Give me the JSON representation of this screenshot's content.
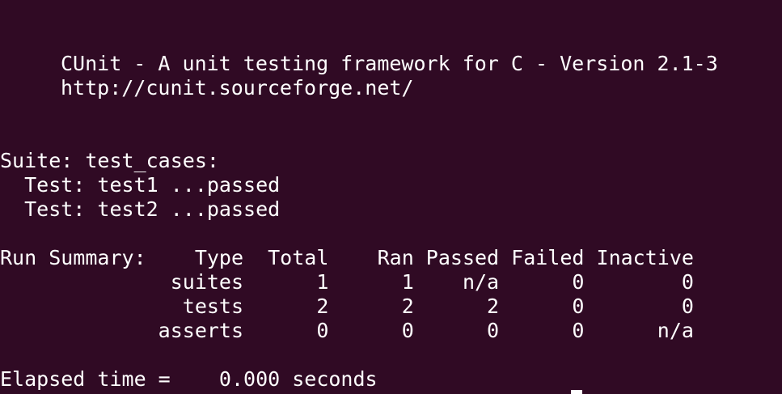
{
  "terminal": {
    "banner": {
      "title": "CUnit - A unit testing framework for C - Version 2.1-3",
      "url": "http://cunit.sourceforge.net/"
    },
    "suite_line": "Suite: test_cases:",
    "tests": [
      "  Test: test1 ...passed",
      "  Test: test2 ...passed"
    ],
    "summary": {
      "header": "Run Summary:    Type  Total    Ran Passed Failed Inactive",
      "rows": [
        "              suites      1      1    n/a      0        0",
        "               tests      2      2      2      0        0",
        "             asserts      0      0      0      0      n/a"
      ]
    },
    "elapsed": "Elapsed time =    0.000 seconds"
  },
  "colors": {
    "background": "#300a24",
    "foreground": "#ffffff",
    "prompt_user": "#4e9a06",
    "prompt_path": "#729fcf"
  }
}
